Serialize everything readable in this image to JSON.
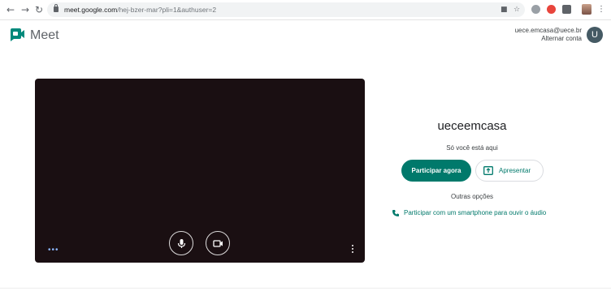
{
  "browser": {
    "url_host": "meet.google.com",
    "url_path": "/hej-bzer-mar?pli=1&authuser=2",
    "back_icon": "arrow-left-icon",
    "forward_icon": "arrow-right-icon",
    "reload_icon": "reload-icon"
  },
  "header": {
    "app_name": "Meet",
    "account_email": "uece.emcasa@uece.br",
    "switch_account_label": "Alternar conta",
    "avatar_initial": "U"
  },
  "meeting": {
    "name": "ueceemcasa",
    "status": "Só você está aqui",
    "join_label": "Participar agora",
    "present_label": "Apresentar",
    "other_options_label": "Outras opções",
    "phone_join_label": "Participar com um smartphone para ouvir o áudio"
  },
  "colors": {
    "accent": "#00796b",
    "video_bg": "#1a0f12",
    "avatar_bg": "#455a64"
  }
}
